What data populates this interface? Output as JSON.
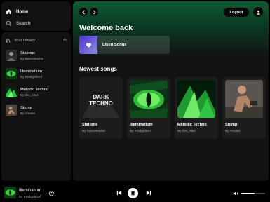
{
  "nav": {
    "home_label": "Home",
    "search_label": "Search"
  },
  "library": {
    "title": "Your Library",
    "items": [
      {
        "title": "Stations",
        "subtitle": "By DanceMuske"
      },
      {
        "title": "Illeminatium",
        "subtitle": "By Kradgnikcuf"
      },
      {
        "title": "Melodic Techno",
        "subtitle": "By Zen_Man"
      },
      {
        "title": "Stomp",
        "subtitle": "By Amaksi"
      }
    ]
  },
  "header": {
    "logout_label": "Logout"
  },
  "main": {
    "welcome": "Welcome back",
    "liked_label": "Liked Songs",
    "newest_title": "Newest songs",
    "cards": [
      {
        "title": "Stations",
        "subtitle": "By DanceMuske",
        "art_text_1": "DARK",
        "art_text_2": "TECHNO"
      },
      {
        "title": "Illeminatium",
        "subtitle": "By Kradgnikcuf"
      },
      {
        "title": "Melodic Techno",
        "subtitle": "By Zen_Man"
      },
      {
        "title": "Stomp",
        "subtitle": "By Amaksi"
      }
    ]
  },
  "player": {
    "title": "Illeminatium",
    "artist": "By Kradgnikcuf",
    "volume_level": 0.55
  },
  "colors": {
    "header_green": "#0f5a33",
    "liked_gradient_start": "#4b2fd4",
    "liked_gradient_end": "#8f8fd8"
  },
  "icons": [
    "home-icon",
    "search-icon",
    "library-icon",
    "plus-icon",
    "back-icon",
    "forward-icon",
    "user-icon",
    "heart-icon",
    "previous-icon",
    "pause-icon",
    "next-icon",
    "volume-icon"
  ]
}
